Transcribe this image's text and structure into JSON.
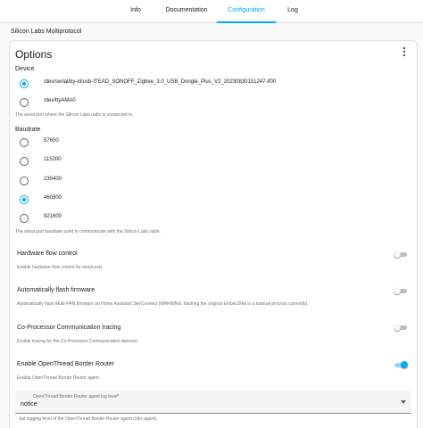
{
  "tabs": [
    {
      "label": "Info",
      "active": false
    },
    {
      "label": "Documentation",
      "active": false
    },
    {
      "label": "Configuration",
      "active": true
    },
    {
      "label": "Log",
      "active": false
    }
  ],
  "addon_name": "Silicon Labs Multiprotocol",
  "options": {
    "title": "Options",
    "more_icon": "more-vertical-icon",
    "device": {
      "label": "Device",
      "options": [
        {
          "label": "/dev/serial/by-id/usb-ITEAD_SONOFF_Zigbee_3.0_USB_Dongle_Plus_V2_20230830151247-if00",
          "selected": true
        },
        {
          "label": "/dev/ttyAMA0",
          "selected": false
        }
      ],
      "helper": "The serial port where the Silicon Labs radio is connected to."
    },
    "baudrate": {
      "label": "Baudrate",
      "options": [
        {
          "label": "57600",
          "selected": false
        },
        {
          "label": "115200",
          "selected": false
        },
        {
          "label": "230400",
          "selected": false
        },
        {
          "label": "460800",
          "selected": true
        },
        {
          "label": "921600",
          "selected": false
        }
      ],
      "helper": "The serial port baudrate used to communicate with the Silicon Labs radio."
    },
    "toggles": [
      {
        "label": "Hardware flow control",
        "helper": "Enable hardware flow control for serial port.",
        "on": false
      },
      {
        "label": "Automatically flash firmware",
        "helper": "Automatically flash Multi-PAN firmware on Home Assistant SkyConnect (WARNING: flashing the original EmberZNet is a manual process currently).",
        "on": false
      },
      {
        "label": "Co-Processor Communication tracing",
        "helper": "Enable tracing for the Co-Processor Communication daemon.",
        "on": false
      },
      {
        "label": "Enable OpenThread Border Router",
        "helper": "Enable OpenThread Border Router agent.",
        "on": true
      }
    ],
    "log_level": {
      "label": "OpenThread Border Router agent log level*",
      "value": "notice",
      "helper": "Set logging level of the OpenThread Border Router agent (otbr-agent)."
    }
  },
  "colors": {
    "accent": "#03a9f4",
    "text": "#212121",
    "helper": "#727272",
    "card_border": "#e0e0e0"
  }
}
